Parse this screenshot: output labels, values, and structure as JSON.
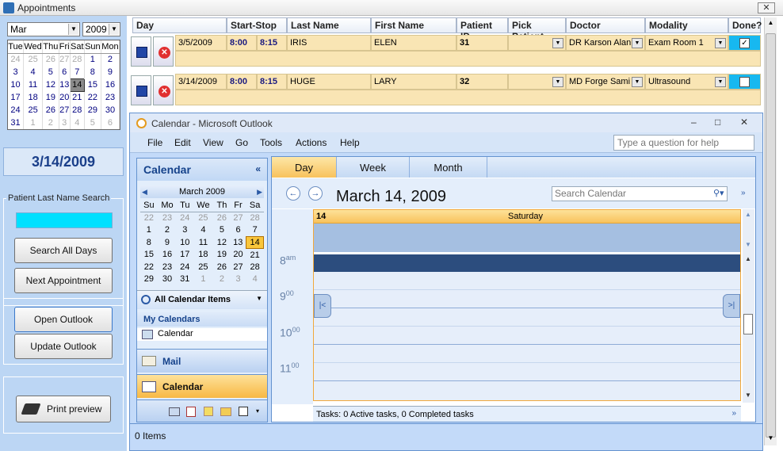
{
  "window": {
    "title": "Appointments",
    "close_label": "✕"
  },
  "left": {
    "month_value": "Mar",
    "year_value": "2009",
    "calendar_days_header": [
      "Tue",
      "Wed",
      "Thu",
      "Fri",
      "Sat",
      "Sun",
      "Mon"
    ],
    "calendar_rows": [
      [
        "24",
        "25",
        "26",
        "27",
        "28",
        "1",
        "2"
      ],
      [
        "3",
        "4",
        "5",
        "6",
        "7",
        "8",
        "9"
      ],
      [
        "10",
        "11",
        "12",
        "13",
        "14",
        "15",
        "16"
      ],
      [
        "17",
        "18",
        "19",
        "20",
        "21",
        "22",
        "23"
      ],
      [
        "24",
        "25",
        "26",
        "27",
        "28",
        "29",
        "30"
      ],
      [
        "31",
        "1",
        "2",
        "3",
        "4",
        "5",
        "6"
      ]
    ],
    "selected_date": "3/14/2009",
    "search_group_label": "Patient Last Name Search",
    "search_value": "",
    "buttons": {
      "search_all": "Search All Days",
      "next_appt": "Next Appointment",
      "open_outlook": "Open Outlook",
      "update_outlook": "Update Outlook",
      "print_preview": "Print preview"
    }
  },
  "grid": {
    "headers": [
      "Day",
      "Start-Stop",
      "Last Name",
      "First Name",
      "Patient ID",
      "Pick Patient",
      "Doctor",
      "Modality",
      "Done?"
    ],
    "rows": [
      {
        "date": "3/5/2009",
        "start": "8:00",
        "stop": "8:15",
        "last": "IRIS",
        "first": "ELEN",
        "pid": "31",
        "pick": "",
        "doctor": "DR Karson Alan",
        "modality": "Exam Room 1",
        "done": "✓"
      },
      {
        "date": "3/14/2009",
        "start": "8:00",
        "stop": "8:15",
        "last": "HUGE",
        "first": "LARY",
        "pid": "32",
        "pick": "",
        "doctor": "MD Forge Sami",
        "modality": "Ultrasound",
        "done": ""
      }
    ]
  },
  "outlook": {
    "title": "Calendar - Microsoft Outlook",
    "menus": [
      "File",
      "Edit",
      "View",
      "Go",
      "Tools",
      "Actions",
      "Help"
    ],
    "help_placeholder": "Type a question for help",
    "nav_title": "Calendar",
    "mini_month": "March 2009",
    "mini_days_header": [
      "Su",
      "Mo",
      "Tu",
      "We",
      "Th",
      "Fr",
      "Sa"
    ],
    "mini_rows": [
      [
        "22",
        "23",
        "24",
        "25",
        "26",
        "27",
        "28"
      ],
      [
        "1",
        "2",
        "3",
        "4",
        "5",
        "6",
        "7"
      ],
      [
        "8",
        "9",
        "10",
        "11",
        "12",
        "13",
        "14"
      ],
      [
        "15",
        "16",
        "17",
        "18",
        "19",
        "20",
        "21"
      ],
      [
        "22",
        "23",
        "24",
        "25",
        "26",
        "27",
        "28"
      ],
      [
        "29",
        "30",
        "31",
        "1",
        "2",
        "3",
        "4"
      ]
    ],
    "all_cal_items": "All Calendar Items",
    "my_calendars": "My Calendars",
    "calendar_item": "Calendar",
    "nav_mail": "Mail",
    "nav_calendar": "Calendar",
    "view_tabs": [
      "Day",
      "Week",
      "Month"
    ],
    "date_heading": "March 14, 2009",
    "search_placeholder": "Search Calendar",
    "day_number": "14",
    "day_name": "Saturday",
    "hours": [
      {
        "h": "8",
        "m": "am"
      },
      {
        "h": "9",
        "m": "00"
      },
      {
        "h": "10",
        "m": "00"
      },
      {
        "h": "11",
        "m": "00"
      }
    ],
    "tasks_line": "Tasks: 0 Active tasks, 0 Completed tasks",
    "status": "0 Items"
  }
}
